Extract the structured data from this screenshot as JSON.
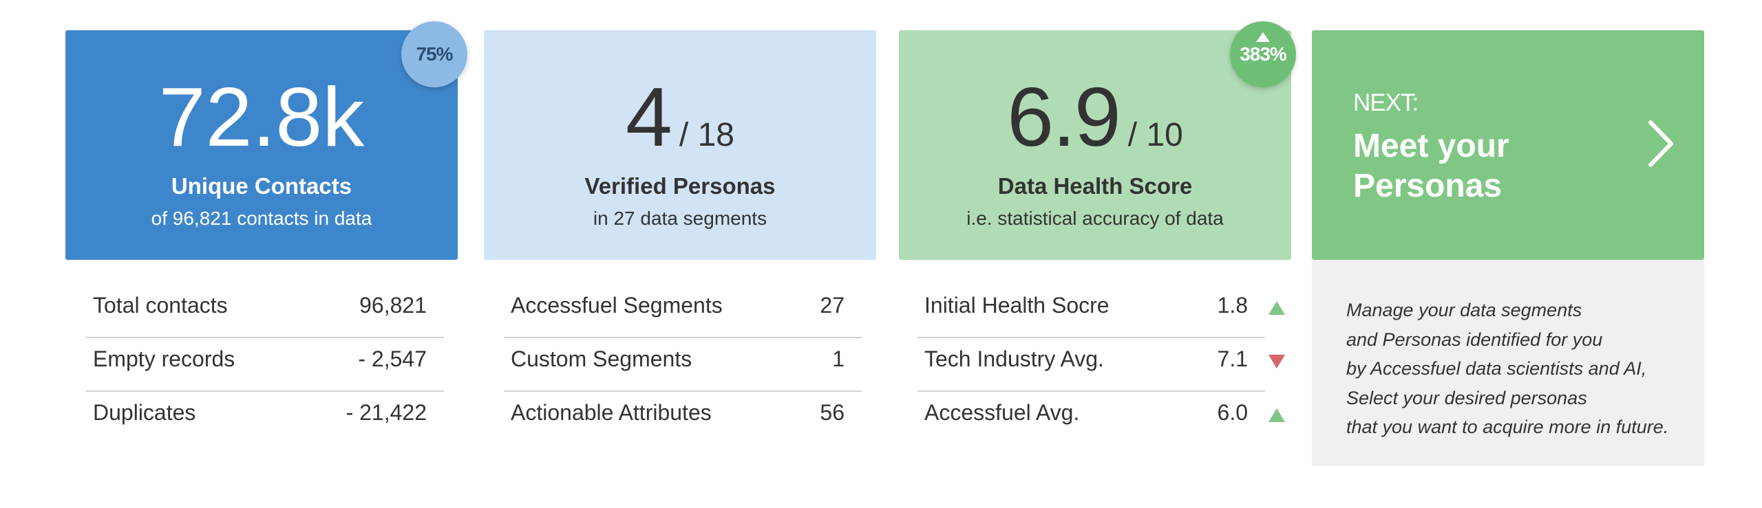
{
  "cards": [
    {
      "big_value": "72.8k",
      "denominator": "",
      "title": "Unique Contacts",
      "subtitle": "of 96,821 contacts in data",
      "badge": "75%",
      "color": "#3e86cb"
    },
    {
      "big_value": "4",
      "denominator": "/ 18",
      "title": "Verified Personas",
      "subtitle": "in 27 data segments",
      "badge": "",
      "color": "#d1e3f5"
    },
    {
      "big_value": "6.9",
      "denominator": "/ 10",
      "title": "Data Health Score",
      "subtitle": "i.e. statistical accuracy of data",
      "badge": "383%",
      "badge_trend": "up",
      "color": "#b0dcb5"
    }
  ],
  "next_card": {
    "label": "NEXT:",
    "title": "Meet your Personas",
    "icon": "chevron-right-icon",
    "color": "#80c785"
  },
  "stats": [
    {
      "rows": [
        {
          "label": "Total contacts",
          "value": "96,821"
        },
        {
          "label": "Empty records",
          "value": "- 2,547"
        },
        {
          "label": "Duplicates",
          "value": "- 21,422"
        }
      ]
    },
    {
      "rows": [
        {
          "label": "Accessfuel Segments",
          "value": "27"
        },
        {
          "label": "Custom Segments",
          "value": "1"
        },
        {
          "label": "Actionable Attributes",
          "value": "56"
        }
      ]
    },
    {
      "rows": [
        {
          "label": "Initial Health Socre",
          "value": "1.8",
          "trend": "up"
        },
        {
          "label": "Tech Industry Avg.",
          "value": "7.1",
          "trend": "down"
        },
        {
          "label": "Accessfuel Avg.",
          "value": "6.0",
          "trend": "up"
        }
      ]
    }
  ],
  "info": {
    "lines": [
      "Manage your data segments",
      "and Personas identified for you",
      "by Accessfuel data scientists and AI,",
      "Select your desired personas",
      "that you want to acquire more in future."
    ]
  },
  "colors": {
    "trend_up": "#7fc784",
    "trend_down": "#d9646b",
    "info_bg": "#f0f0f0"
  }
}
